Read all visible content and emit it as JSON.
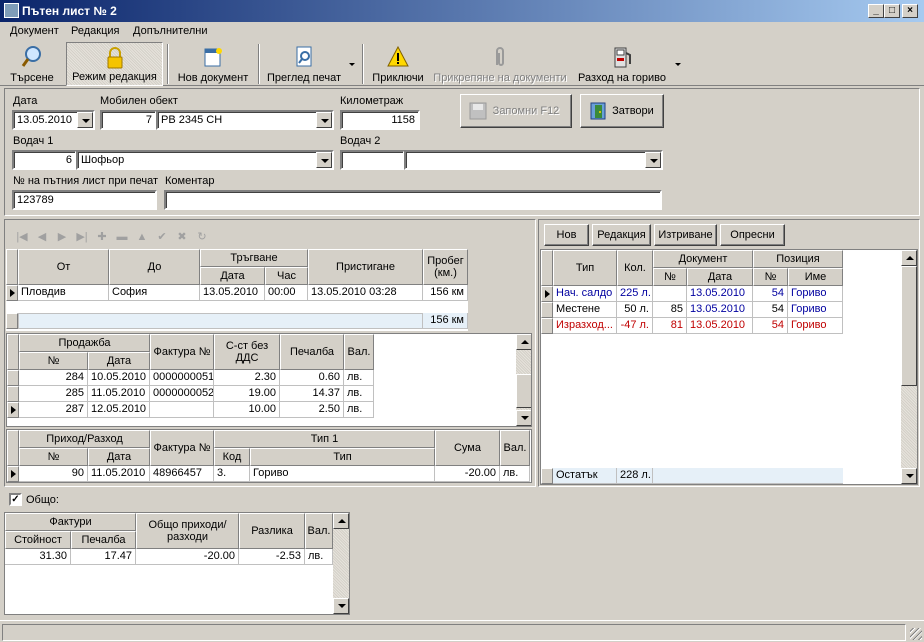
{
  "window": {
    "title": "Пътен лист № 2"
  },
  "menu": [
    "Документ",
    "Редакция",
    "Допълнителни"
  ],
  "toolbar": {
    "search": "Търсене",
    "edit_mode": "Режим редакция",
    "new_doc": "Нов документ",
    "print_preview": "Преглед печат",
    "finish": "Приключи",
    "attach": "Прикрепяне на документи",
    "fuel": "Разход на гориво"
  },
  "form": {
    "date_label": "Дата",
    "date_value": "13.05.2010",
    "vehicle_label": "Мобилен обект",
    "vehicle_id": "7",
    "vehicle_name": "РВ 2345 СН",
    "km_label": "Километраж",
    "km_value": "1158",
    "save_button": "Запомни  F12",
    "close_button": "Затвори",
    "driver1_label": "Водач 1",
    "driver1_id": "6",
    "driver1_name": "Шофьор",
    "driver2_label": "Водач 2",
    "driver2_id": "",
    "driver2_name": "",
    "print_no_label": "№ на пътния лист при печат",
    "print_no_value": "123789",
    "comment_label": "Коментар",
    "comment_value": ""
  },
  "trips": {
    "headers": {
      "from": "От",
      "to": "До",
      "departure": "Тръгване",
      "dep_date": "Дата",
      "dep_time": "Час",
      "arrival": "Пристигане",
      "mileage": "Пробег (км.)"
    },
    "rows": [
      {
        "from": "Пловдив",
        "to": "София",
        "date": "13.05.2010",
        "time": "00:00",
        "arrival": "13.05.2010 03:28",
        "mileage": "156 км"
      }
    ],
    "total": "156 км"
  },
  "sales": {
    "headers": {
      "sale": "Продажба",
      "no": "№",
      "date": "Дата",
      "invoice": "Фактура №",
      "cost": "С-ст без ДДС",
      "profit": "Печалба",
      "currency": "Вал."
    },
    "rows": [
      {
        "no": "284",
        "date": "10.05.2010",
        "invoice": "0000000051",
        "cost": "2.30",
        "profit": "0.60",
        "currency": "лв."
      },
      {
        "no": "285",
        "date": "11.05.2010",
        "invoice": "0000000052",
        "cost": "19.00",
        "profit": "14.37",
        "currency": "лв."
      },
      {
        "no": "287",
        "date": "12.05.2010",
        "invoice": "",
        "cost": "10.00",
        "profit": "2.50",
        "currency": "лв."
      }
    ]
  },
  "income": {
    "headers": {
      "group": "Приход/Разход",
      "no": "№",
      "date": "Дата",
      "invoice": "Фактура №",
      "type1": "Тип 1",
      "code": "Код",
      "type": "Тип",
      "amount": "Сума",
      "currency": "Вал."
    },
    "rows": [
      {
        "no": "90",
        "date": "11.05.2010",
        "invoice": "48966457",
        "code": "3.",
        "type": "Гориво",
        "amount": "-20.00",
        "currency": "лв."
      }
    ]
  },
  "right_panel": {
    "buttons": {
      "new": "Нов",
      "edit": "Редакция",
      "delete": "Изтриване",
      "refresh": "Опресни"
    },
    "headers": {
      "type": "Тип",
      "qty": "Кол.",
      "document": "Документ",
      "doc_no": "№",
      "doc_date": "Дата",
      "position": "Позиция",
      "pos_no": "№",
      "pos_name": "Име"
    },
    "rows": [
      {
        "type": "Нач. салдо",
        "qty": "225 л.",
        "doc_no": "",
        "doc_date": "13.05.2010",
        "pos_no": "54",
        "pos_name": "Гориво",
        "color": "#0000a0"
      },
      {
        "type": "Местене",
        "qty": "50 л.",
        "doc_no": "85",
        "doc_date": "13.05.2010",
        "pos_no": "54",
        "pos_name": "Гориво",
        "color": "#000000"
      },
      {
        "type": "Изразход...",
        "qty": "-47 л.",
        "doc_no": "81",
        "doc_date": "13.05.2010",
        "pos_no": "54",
        "pos_name": "Гориво",
        "color": "#c00000"
      }
    ],
    "footer": {
      "label": "Остатък",
      "qty": "228 л."
    }
  },
  "summary": {
    "checkbox_label": "Общо:",
    "checked": true,
    "headers": {
      "invoices": "Фактури",
      "value": "Стойност",
      "profit": "Печалба",
      "total_io": "Общо приходи/разходи",
      "diff": "Разлика",
      "currency": "Вал."
    },
    "row": {
      "value": "31.30",
      "profit": "17.47",
      "total_io": "-20.00",
      "diff": "-2.53",
      "currency": "лв."
    }
  }
}
